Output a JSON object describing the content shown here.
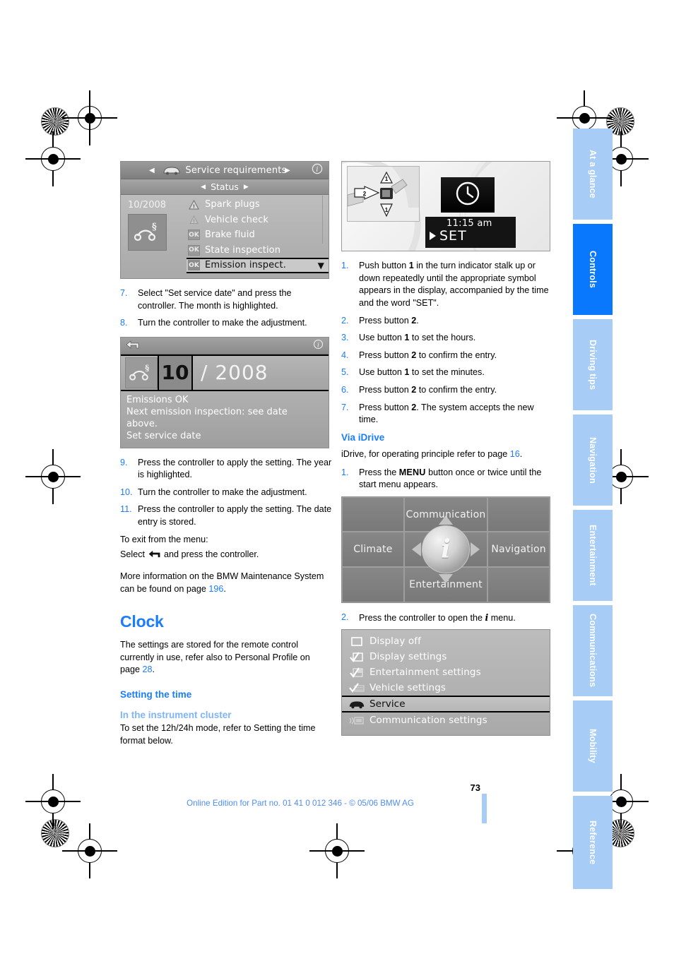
{
  "page": {
    "number": "73",
    "footer": "Online Edition for Part no. 01 41 0 012 346 - © 05/06 BMW AG"
  },
  "sidebar": {
    "tabs": [
      {
        "label": "At a glance",
        "active": false
      },
      {
        "label": "Controls",
        "active": true
      },
      {
        "label": "Driving tips",
        "active": false
      },
      {
        "label": "Navigation",
        "active": false
      },
      {
        "label": "Entertainment",
        "active": false
      },
      {
        "label": "Communications",
        "active": false
      },
      {
        "label": "Mobility",
        "active": false
      },
      {
        "label": "Reference",
        "active": false
      }
    ]
  },
  "colors": {
    "accent_blue": "#1a7dfa",
    "tab_active": "#0a78fc",
    "tab_inactive": "#a7ccf6",
    "subheading_light": "#7fb4f7"
  },
  "figures": {
    "service_requirements": {
      "title": "Service requirements",
      "subtitle": "Status",
      "date": "10/2008",
      "info_icon": "info-icon",
      "car_icon": "car-icon",
      "items": [
        {
          "badge": "warn",
          "label": "Spark plugs"
        },
        {
          "badge": "warn2",
          "label": "Vehicle check"
        },
        {
          "badge": "OK",
          "label": "Brake fluid"
        },
        {
          "badge": "OK",
          "label": "State inspection"
        },
        {
          "badge": "OK",
          "label": "Emission inspect.",
          "selected": true
        }
      ]
    },
    "stalk_clock": {
      "callout_1": "1",
      "callout_1b": "1",
      "callout_2": "2",
      "clock_icon": "clock-icon",
      "time": "11:15 am",
      "set_label": "SET"
    },
    "date_entry": {
      "back_icon": "back-arrow-icon",
      "info_icon": "info-icon",
      "service_icon": "service-wrench-icon",
      "month": "10",
      "separator": "/",
      "year": "2008",
      "lines": [
        "Emissions OK",
        "Next emission inspection: see date",
        "above.",
        "Set service date"
      ]
    },
    "start_menu": {
      "top": "Communication",
      "left": "Climate",
      "right": "Navigation",
      "bottom": "Entertainment",
      "center_icon": "i-info-icon"
    },
    "settings_menu": {
      "items": [
        {
          "icon": "display-off-icon",
          "label": "Display off",
          "selected": false
        },
        {
          "icon": "display-settings-icon",
          "label": "Display settings",
          "selected": false
        },
        {
          "icon": "entertainment-settings-icon",
          "label": "Entertainment settings",
          "selected": false
        },
        {
          "icon": "vehicle-settings-icon",
          "label": "Vehicle settings",
          "selected": false
        },
        {
          "icon": "car-icon",
          "label": "Service",
          "selected": true
        },
        {
          "icon": "communication-settings-icon",
          "label": "Communication settings",
          "selected": false
        }
      ]
    }
  },
  "left_column": {
    "steps_top": [
      {
        "num": "7.",
        "text": "Select \"Set service date\" and press the controller. The month is highlighted."
      },
      {
        "num": "8.",
        "text": "Turn the controller to make the adjustment."
      }
    ],
    "steps_bottom": [
      {
        "num": "9.",
        "text": "Press the controller to apply the setting. The year is highlighted."
      },
      {
        "num": "10.",
        "text": "Turn the controller to make the adjustment."
      },
      {
        "num": "11.",
        "text": "Press the controller to apply the setting. The date entry is stored."
      }
    ],
    "exit_line1": "To exit from the menu:",
    "exit_line2_pre": "Select ",
    "exit_line2_post": " and press the controller.",
    "exit_icon": "back-arrow-icon",
    "more_info_pre": "More information on the BMW Maintenance System can be found on page ",
    "more_info_page": "196",
    "more_info_post": ".",
    "clock_heading": "Clock",
    "clock_para_pre": "The settings are stored for the remote control currently in use, refer also to Personal Profile on page ",
    "clock_para_page": "28",
    "clock_para_post": ".",
    "setting_time_heading": "Setting the time",
    "instrument_cluster_heading": "In the instrument cluster",
    "instrument_cluster_text": "To set the 12h/24h mode, refer to Setting the time format below."
  },
  "right_column": {
    "steps": [
      {
        "num": "1.",
        "pre": "Push button ",
        "bold": "1",
        "post": " in the turn indicator stalk up or down repeatedly until the appropriate symbol appears in the display, accompanied by the time and the word \"SET\"."
      },
      {
        "num": "2.",
        "pre": "Press button ",
        "bold": "2",
        "post": "."
      },
      {
        "num": "3.",
        "pre": "Use button ",
        "bold": "1",
        "post": " to set the hours."
      },
      {
        "num": "4.",
        "pre": "Press button ",
        "bold": "2",
        "post": " to confirm the entry."
      },
      {
        "num": "5.",
        "pre": "Use button ",
        "bold": "1",
        "post": " to set the minutes."
      },
      {
        "num": "6.",
        "pre": "Press button ",
        "bold": "2",
        "post": " to confirm the entry."
      },
      {
        "num": "7.",
        "pre": "Press button ",
        "bold": "2",
        "post": ". The system accepts the new time."
      }
    ],
    "via_idrive_heading": "Via iDrive",
    "idrive_ref_pre": "iDrive, for operating principle refer to page ",
    "idrive_ref_page": "16",
    "idrive_ref_post": ".",
    "step_menu_num": "1.",
    "step_menu_pre": "Press the ",
    "step_menu_bold": "MENU",
    "step_menu_post": " button once or twice until the start menu appears.",
    "step_controller_num": "2.",
    "step_controller_pre": "Press the controller to open the ",
    "step_controller_icon": "i-info-icon",
    "step_controller_post": " menu."
  }
}
